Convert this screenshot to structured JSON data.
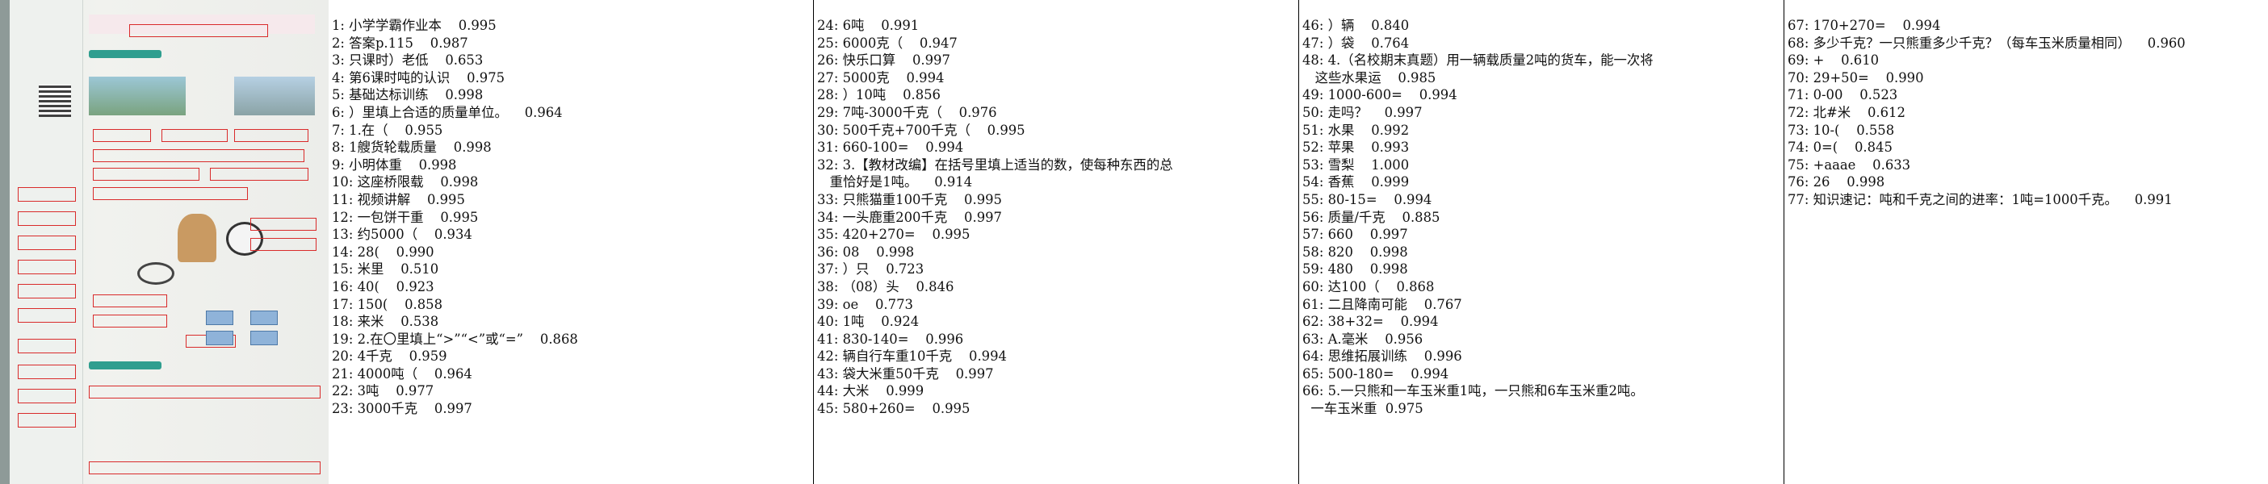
{
  "columns": [
    {
      "lines": [
        "1: 小学学霸作业本    0.995",
        "2: 答案p.115    0.987",
        "3: 只课时）老低    0.653",
        "4: 第6课时吨的认识    0.975",
        "5: 基础达标训练    0.998",
        "6: ）里填上合适的质量单位。    0.964",
        "7: 1.在（    0.955",
        "8: 1艘货轮载质量    0.998",
        "9: 小明体重    0.998",
        "10: 这座桥限载    0.998",
        "11: 视频讲解    0.995",
        "12: 一包饼干重    0.995",
        "13: 约5000（    0.934",
        "14: 28(    0.990",
        "15: 米里    0.510",
        "16: 40(    0.923",
        "17: 150(    0.858",
        "18: 来米    0.538",
        "19: 2.在〇里填上“>”“<”或“=”    0.868",
        "20: 4千克    0.959",
        "21: 4000吨（    0.964",
        "22: 3吨    0.977",
        "23: 3000千克    0.997"
      ]
    },
    {
      "lines": [
        "24: 6吨    0.991",
        "25: 6000克（    0.947",
        "26: 快乐口算    0.997",
        "27: 5000克    0.994",
        "28: ）10吨    0.856",
        "29: 7吨-3000千克（    0.976",
        "30: 500千克+700千克（    0.995",
        "31: 660-100=    0.994",
        "32: 3.【教材改编】在括号里填上适当的数，使每种东西的总",
        "   重恰好是1吨。    0.914",
        "33: 只熊猫重100千克    0.995",
        "34: 一头鹿重200千克    0.997",
        "35: 420+270=    0.995",
        "36: 08    0.998",
        "37: ）只    0.723",
        "38: （08）头    0.846",
        "39: oe    0.773",
        "40: 1吨    0.924",
        "41: 830-140=    0.996",
        "42: 辆自行车重10千克    0.994",
        "43: 袋大米重50千克    0.997",
        "44: 大米    0.999",
        "45: 580+260=    0.995"
      ]
    },
    {
      "lines": [
        "46: ）辆    0.840",
        "47: ）袋    0.764",
        "48: 4.（名校期末真题）用一辆载质量2吨的货车，能一次将",
        "   这些水果运    0.985",
        "49: 1000-600=    0.994",
        "50: 走吗？    0.997",
        "51: 水果    0.992",
        "52: 苹果    0.993",
        "53: 雪梨    1.000",
        "54: 香蕉    0.999",
        "55: 80-15=    0.994",
        "56: 质量/千克    0.885",
        "57: 660    0.997",
        "58: 820    0.998",
        "59: 480    0.998",
        "60: 达100（    0.868",
        "61: 二且降南可能    0.767",
        "62: 38+32=    0.994",
        "63: A.毫米    0.956",
        "64: 思维拓展训练    0.996",
        "65: 500-180=    0.994",
        "66: 5.一只熊和一车玉米重1吨，一只熊和6车玉米重2吨。",
        "  一车玉米重  0.975"
      ]
    },
    {
      "lines": [
        "67: 170+270=    0.994",
        "68: 多少千克？一只熊重多少千克？（每车玉米质量相同）    0.960",
        "69: +    0.610",
        "70: 29+50=    0.990",
        "71: 0-00    0.523",
        "72: 北#米    0.612",
        "73: 10-(    0.558",
        "74: 0=(    0.845",
        "75: +aaae    0.633",
        "76: 26    0.998",
        "77: 知识速记：吨和千克之间的进率：1吨=1000千克。    0.991"
      ]
    }
  ]
}
